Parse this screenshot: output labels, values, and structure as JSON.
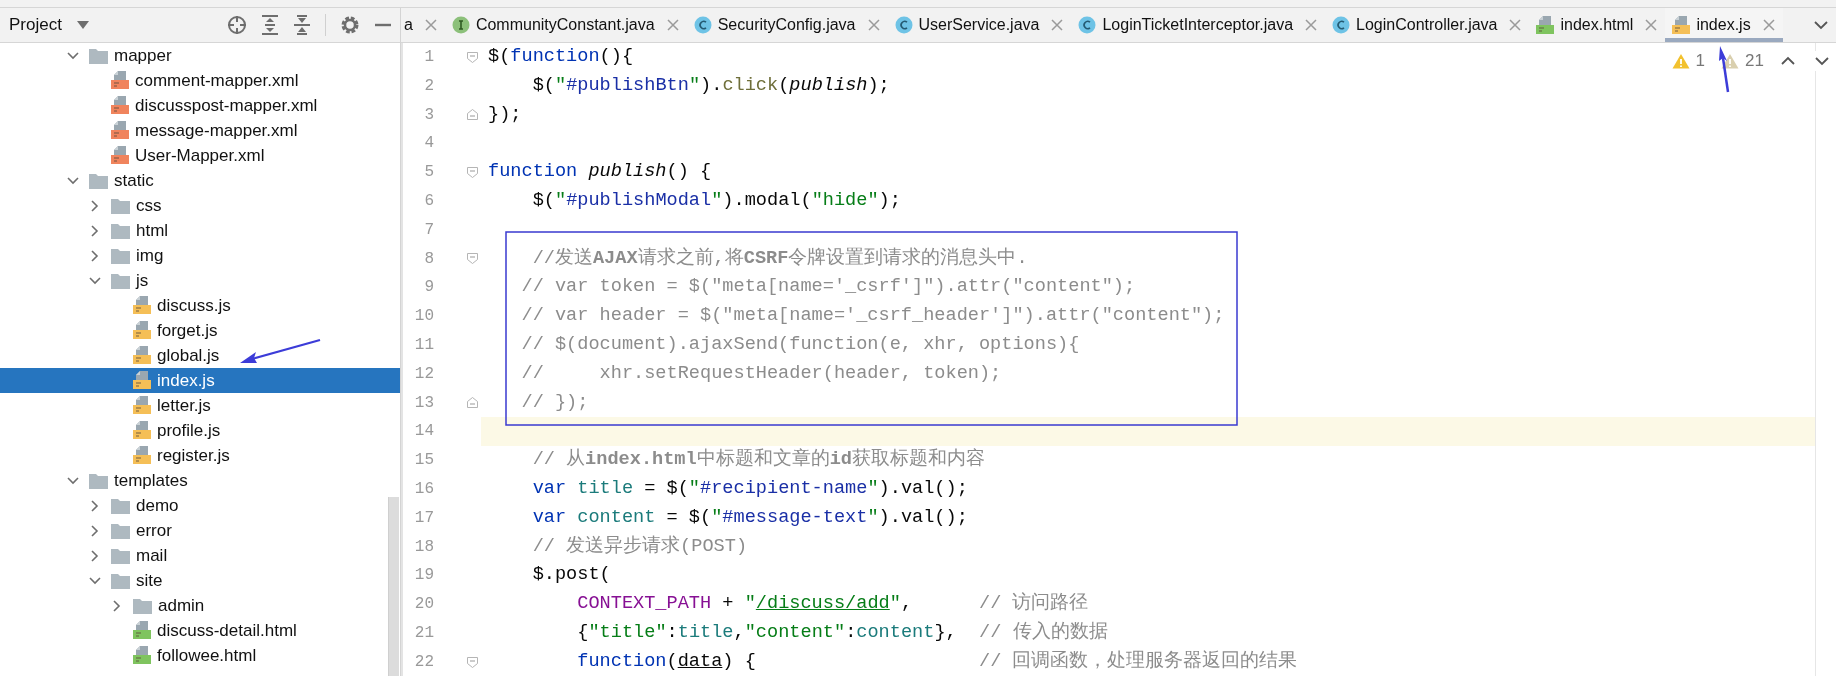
{
  "project_panel": {
    "title": "Project",
    "tree": [
      {
        "label": "mapper",
        "kind": "folder",
        "expanded": true,
        "selected": false,
        "children": [
          {
            "label": "comment-mapper.xml",
            "kind": "xml",
            "selected": false
          },
          {
            "label": "discusspost-mapper.xml",
            "kind": "xml",
            "selected": false
          },
          {
            "label": "message-mapper.xml",
            "kind": "xml",
            "selected": false
          },
          {
            "label": "User-Mapper.xml",
            "kind": "xml",
            "selected": false
          }
        ]
      },
      {
        "label": "static",
        "kind": "folder",
        "expanded": true,
        "selected": false,
        "children": [
          {
            "label": "css",
            "kind": "folder",
            "expanded": false,
            "selected": false
          },
          {
            "label": "html",
            "kind": "folder",
            "expanded": false,
            "selected": false
          },
          {
            "label": "img",
            "kind": "folder",
            "expanded": false,
            "selected": false
          },
          {
            "label": "js",
            "kind": "folder",
            "expanded": true,
            "selected": false,
            "children": [
              {
                "label": "discuss.js",
                "kind": "js",
                "selected": false
              },
              {
                "label": "forget.js",
                "kind": "js",
                "selected": false
              },
              {
                "label": "global.js",
                "kind": "js",
                "selected": false
              },
              {
                "label": "index.js",
                "kind": "js",
                "selected": true
              },
              {
                "label": "letter.js",
                "kind": "js",
                "selected": false
              },
              {
                "label": "profile.js",
                "kind": "js",
                "selected": false
              },
              {
                "label": "register.js",
                "kind": "js",
                "selected": false
              }
            ]
          }
        ]
      },
      {
        "label": "templates",
        "kind": "folder",
        "expanded": true,
        "selected": false,
        "children": [
          {
            "label": "demo",
            "kind": "folder",
            "expanded": false,
            "selected": false
          },
          {
            "label": "error",
            "kind": "folder",
            "expanded": false,
            "selected": false
          },
          {
            "label": "mail",
            "kind": "folder",
            "expanded": false,
            "selected": false
          },
          {
            "label": "site",
            "kind": "folder",
            "expanded": true,
            "selected": false,
            "children": [
              {
                "label": "admin",
                "kind": "folder",
                "expanded": false,
                "selected": false
              },
              {
                "label": "discuss-detail.html",
                "kind": "html",
                "selected": false
              },
              {
                "label": "followee.html",
                "kind": "html",
                "selected": false
              }
            ]
          }
        ]
      }
    ]
  },
  "tabs": [
    {
      "label": "a",
      "kind": "cut",
      "selected": false
    },
    {
      "label": "CommunityConstant.java",
      "kind": "interface",
      "selected": false
    },
    {
      "label": "SecurityConfig.java",
      "kind": "class",
      "selected": false
    },
    {
      "label": "UserService.java",
      "kind": "class",
      "selected": false
    },
    {
      "label": "LoginTicketInterceptor.java",
      "kind": "class",
      "selected": false
    },
    {
      "label": "LoginController.java",
      "kind": "class",
      "selected": false
    },
    {
      "label": "index.html",
      "kind": "html",
      "selected": false
    },
    {
      "label": "index.js",
      "kind": "js",
      "selected": true
    }
  ],
  "editor": {
    "inspections": [
      {
        "kind": "warning",
        "count": "1"
      },
      {
        "kind": "weak-warning",
        "count": "21"
      }
    ],
    "lines": [
      {
        "number": "1",
        "current": false,
        "fold_start": true,
        "fold_end": false,
        "tokens": [
          {
            "text": "$(",
            "kind": "plain"
          },
          {
            "text": "function",
            "kind": "keyword"
          },
          {
            "text": "(){",
            "kind": "plain"
          }
        ]
      },
      {
        "number": "2",
        "current": false,
        "fold_start": false,
        "fold_end": false,
        "tokens": [
          {
            "text": "    $(",
            "kind": "plain"
          },
          {
            "text": "\"",
            "kind": "string"
          },
          {
            "text": "#publishBtn",
            "kind": "selector"
          },
          {
            "text": "\"",
            "kind": "string"
          },
          {
            "text": ").",
            "kind": "plain"
          },
          {
            "text": "click",
            "kind": "method"
          },
          {
            "text": "(",
            "kind": "plain"
          },
          {
            "text": "publish",
            "kind": "italic"
          },
          {
            "text": ");",
            "kind": "plain"
          }
        ]
      },
      {
        "number": "3",
        "current": false,
        "fold_start": false,
        "fold_end": true,
        "tokens": [
          {
            "text": "});",
            "kind": "plain"
          }
        ]
      },
      {
        "number": "4",
        "current": false,
        "fold_start": false,
        "fold_end": false
      },
      {
        "number": "5",
        "current": false,
        "fold_start": true,
        "fold_end": false,
        "tokens": [
          {
            "text": "function",
            "kind": "keyword"
          },
          {
            "text": " publish",
            "kind": "italic"
          },
          {
            "text": "() {",
            "kind": "plain"
          }
        ]
      },
      {
        "number": "6",
        "current": false,
        "fold_start": false,
        "fold_end": false,
        "tokens": [
          {
            "text": "    $(",
            "kind": "plain"
          },
          {
            "text": "\"",
            "kind": "string"
          },
          {
            "text": "#publishModal",
            "kind": "selector"
          },
          {
            "text": "\"",
            "kind": "string"
          },
          {
            "text": ").modal(",
            "kind": "plain"
          },
          {
            "text": "\"hide\"",
            "kind": "string"
          },
          {
            "text": ");",
            "kind": "plain"
          }
        ]
      },
      {
        "number": "7",
        "current": false,
        "fold_start": false,
        "fold_end": false
      },
      {
        "number": "8",
        "current": false,
        "fold_start": true,
        "fold_end": false,
        "tokens": [
          {
            "text": "    //发送",
            "kind": "comment"
          },
          {
            "text": "AJAX",
            "kind": "comment-bold"
          },
          {
            "text": "请求之前,将",
            "kind": "comment"
          },
          {
            "text": "CSRF",
            "kind": "comment-bold"
          },
          {
            "text": "令牌设置到请求的消息头中.",
            "kind": "comment"
          }
        ]
      },
      {
        "number": "9",
        "current": false,
        "fold_start": false,
        "fold_end": false,
        "tokens": [
          {
            "text": "   // var token = $(\"meta[name='_csrf']\").attr(\"content\");",
            "kind": "comment"
          }
        ]
      },
      {
        "number": "10",
        "current": false,
        "fold_start": false,
        "fold_end": false,
        "tokens": [
          {
            "text": "   // var header = $(\"meta[name='_csrf_header']\").attr(\"content\");",
            "kind": "comment"
          }
        ]
      },
      {
        "number": "11",
        "current": false,
        "fold_start": false,
        "fold_end": false,
        "tokens": [
          {
            "text": "   // $(document).ajaxSend(function(e, xhr, options){",
            "kind": "comment"
          }
        ]
      },
      {
        "number": "12",
        "current": false,
        "fold_start": false,
        "fold_end": false,
        "tokens": [
          {
            "text": "   //     xhr.setRequestHeader(header, token);",
            "kind": "comment"
          }
        ]
      },
      {
        "number": "13",
        "current": false,
        "fold_start": false,
        "fold_end": true,
        "tokens": [
          {
            "text": "   // });",
            "kind": "comment"
          }
        ]
      },
      {
        "number": "14",
        "current": true,
        "fold_start": false,
        "fold_end": false
      },
      {
        "number": "15",
        "current": false,
        "fold_start": false,
        "fold_end": false,
        "tokens": [
          {
            "text": "    // 从",
            "kind": "comment"
          },
          {
            "text": "index.html",
            "kind": "comment-bold"
          },
          {
            "text": "中标题和文章的",
            "kind": "comment"
          },
          {
            "text": "id",
            "kind": "comment-bold"
          },
          {
            "text": "获取标题和内容",
            "kind": "comment"
          }
        ]
      },
      {
        "number": "16",
        "current": false,
        "fold_start": false,
        "fold_end": false,
        "tokens": [
          {
            "text": "    var",
            "kind": "keyword"
          },
          {
            "text": " title",
            "kind": "field"
          },
          {
            "text": " = $(",
            "kind": "plain"
          },
          {
            "text": "\"",
            "kind": "string"
          },
          {
            "text": "#recipient-name",
            "kind": "selector"
          },
          {
            "text": "\"",
            "kind": "string"
          },
          {
            "text": ").val();",
            "kind": "plain"
          }
        ]
      },
      {
        "number": "17",
        "current": false,
        "fold_start": false,
        "fold_end": false,
        "tokens": [
          {
            "text": "    var",
            "kind": "keyword"
          },
          {
            "text": " content",
            "kind": "field"
          },
          {
            "text": " = $(",
            "kind": "plain"
          },
          {
            "text": "\"",
            "kind": "string"
          },
          {
            "text": "#message-text",
            "kind": "selector"
          },
          {
            "text": "\"",
            "kind": "string"
          },
          {
            "text": ").val();",
            "kind": "plain"
          }
        ]
      },
      {
        "number": "18",
        "current": false,
        "fold_start": false,
        "fold_end": false,
        "tokens": [
          {
            "text": "    // 发送异步请求(POST)",
            "kind": "comment"
          }
        ]
      },
      {
        "number": "19",
        "current": false,
        "fold_start": false,
        "fold_end": false,
        "tokens": [
          {
            "text": "    $.post(",
            "kind": "plain"
          }
        ]
      },
      {
        "number": "20",
        "current": false,
        "fold_start": false,
        "fold_end": false,
        "tokens": [
          {
            "text": "        CONTEXT_PATH",
            "kind": "constant"
          },
          {
            "text": " + ",
            "kind": "plain"
          },
          {
            "text": "\"",
            "kind": "string"
          },
          {
            "text": "/discuss/add",
            "kind": "link"
          },
          {
            "text": "\"",
            "kind": "string"
          },
          {
            "text": ",      ",
            "kind": "plain"
          },
          {
            "text": "// 访问路径",
            "kind": "comment"
          }
        ]
      },
      {
        "number": "21",
        "current": false,
        "fold_start": false,
        "fold_end": false,
        "tokens": [
          {
            "text": "        {",
            "kind": "plain"
          },
          {
            "text": "\"title\"",
            "kind": "string"
          },
          {
            "text": ":",
            "kind": "plain"
          },
          {
            "text": "title",
            "kind": "field"
          },
          {
            "text": ",",
            "kind": "plain"
          },
          {
            "text": "\"content\"",
            "kind": "string"
          },
          {
            "text": ":",
            "kind": "plain"
          },
          {
            "text": "content",
            "kind": "field"
          },
          {
            "text": "},  ",
            "kind": "plain"
          },
          {
            "text": "// 传入的数据",
            "kind": "comment"
          }
        ]
      },
      {
        "number": "22",
        "current": false,
        "fold_start": true,
        "fold_end": false,
        "tokens": [
          {
            "text": "        function",
            "kind": "keyword"
          },
          {
            "text": "(",
            "kind": "plain"
          },
          {
            "text": "data",
            "kind": "underline"
          },
          {
            "text": ") {                    ",
            "kind": "plain"
          },
          {
            "text": "// 回调函数，处理服务器返回的结果",
            "kind": "comment"
          }
        ]
      }
    ]
  }
}
